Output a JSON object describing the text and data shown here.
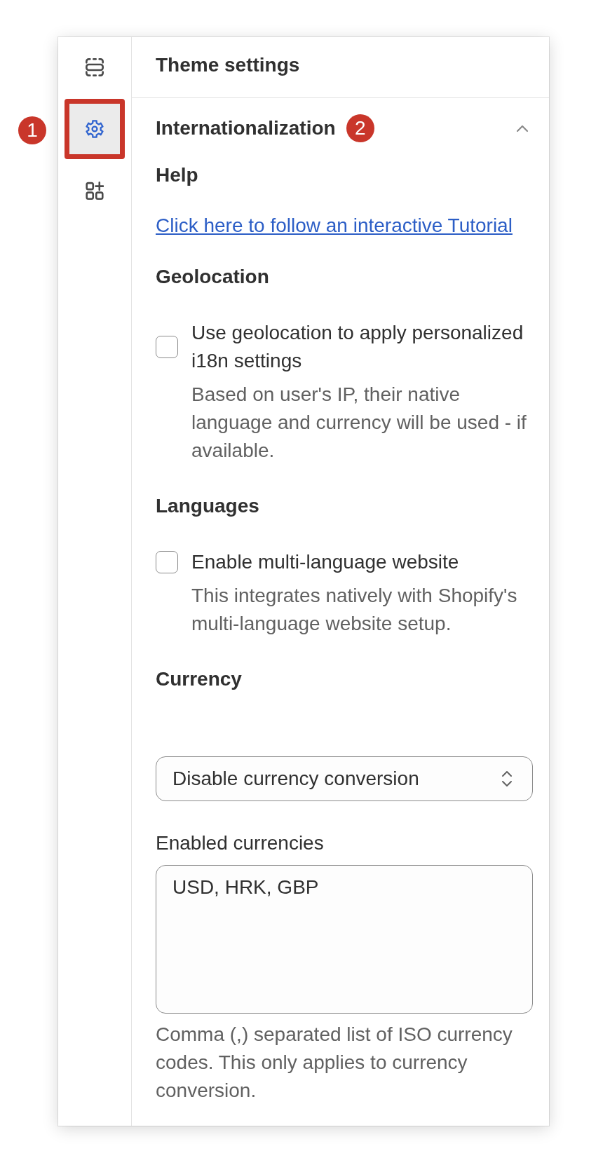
{
  "sidebar": {
    "items": [
      {
        "selected": false
      },
      {
        "selected": true,
        "callout": "1"
      },
      {
        "selected": false
      }
    ]
  },
  "panel": {
    "title": "Theme settings",
    "section": {
      "title": "Internationalization",
      "callout": "2",
      "expanded": true,
      "items": [
        {
          "kind": "heading",
          "text": "Help"
        },
        {
          "kind": "link",
          "text": "Click here to follow an interactive Tutorial"
        },
        {
          "kind": "heading",
          "text": "Geolocation"
        },
        {
          "kind": "checkbox",
          "label": "Use geolocation to apply personalized i18n settings",
          "checked": false,
          "help": "Based on user's IP, their native language and currency will be used - if available."
        },
        {
          "kind": "heading",
          "text": "Languages"
        },
        {
          "kind": "checkbox",
          "label": "Enable multi-language website",
          "checked": false,
          "help": "This integrates natively with Shopify's multi-language website setup."
        },
        {
          "kind": "heading",
          "text": "Currency"
        },
        {
          "kind": "select",
          "value": "Disable currency conversion"
        },
        {
          "kind": "textarea",
          "label": "Enabled currencies",
          "value": "USD, HRK, GBP",
          "help": "Comma (,) separated list of ISO currency codes. This only applies to currency conversion."
        }
      ]
    }
  }
}
